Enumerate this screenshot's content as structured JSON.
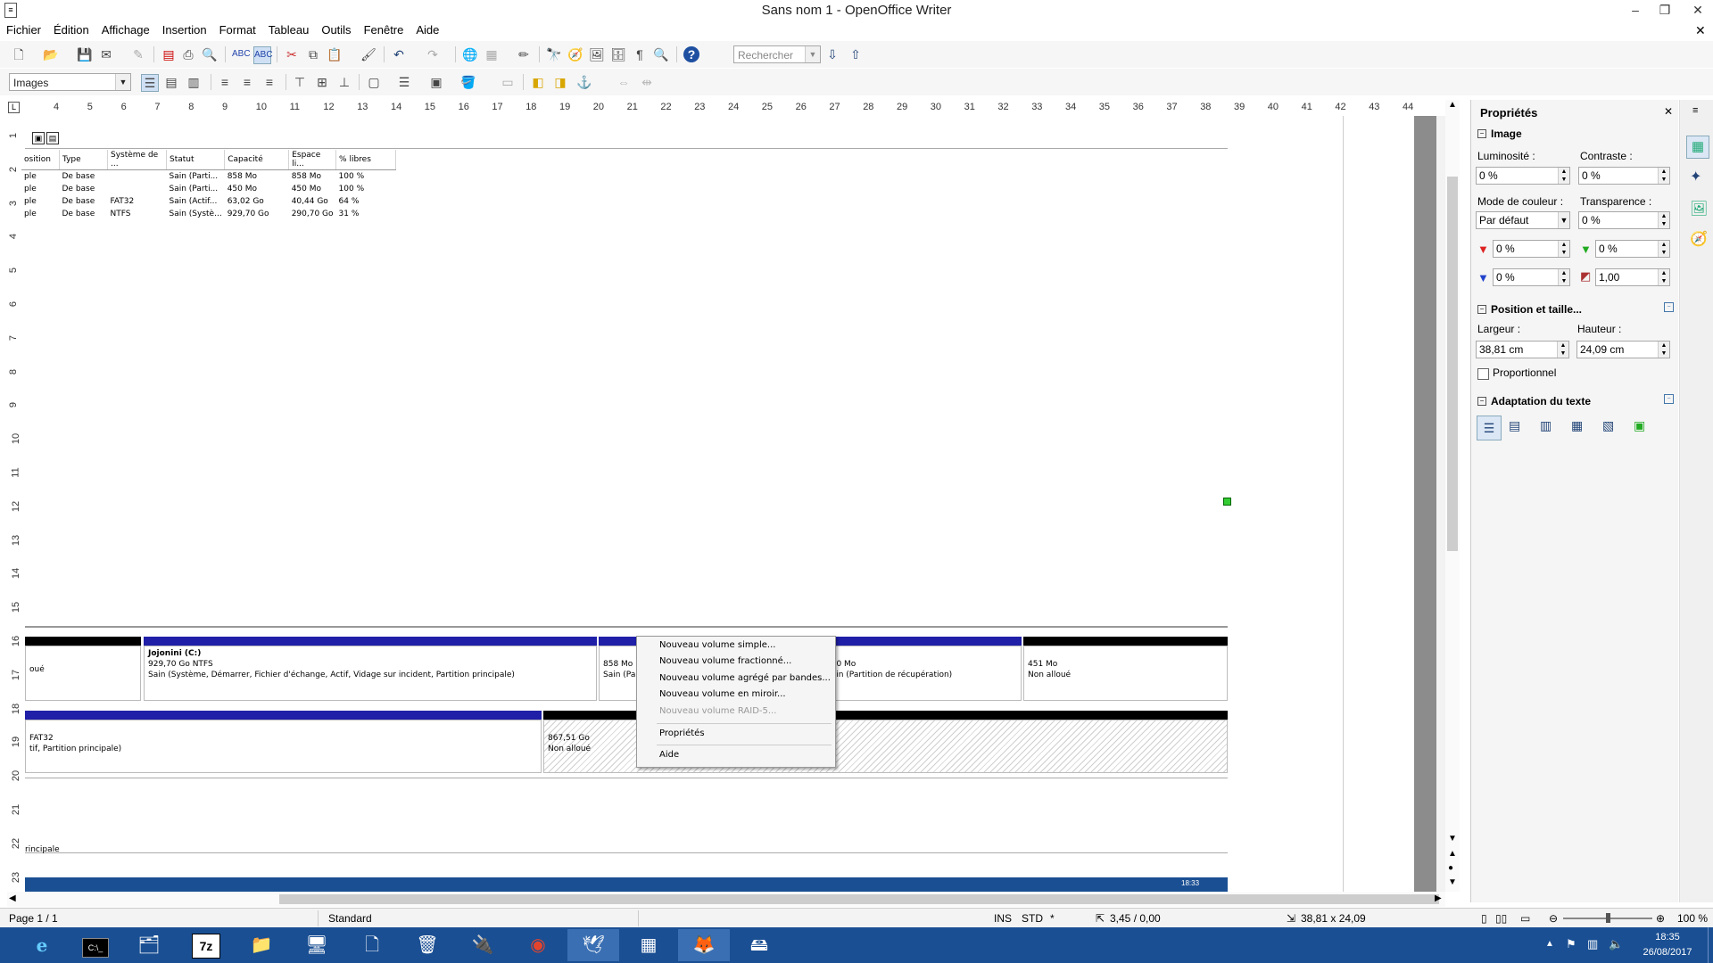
{
  "window": {
    "title": "Sans nom 1 - OpenOffice Writer"
  },
  "menu": [
    "Fichier",
    "Édition",
    "Affichage",
    "Insertion",
    "Format",
    "Tableau",
    "Outils",
    "Fenêtre",
    "Aide"
  ],
  "toolbar1": {
    "search_placeholder": "Rechercher"
  },
  "toolbar2": {
    "style_value": "Images"
  },
  "ruler": {
    "h": [
      "4",
      "5",
      "6",
      "7",
      "8",
      "9",
      "10",
      "11",
      "12",
      "13",
      "14",
      "15",
      "16",
      "17",
      "18",
      "19",
      "20",
      "21",
      "22",
      "23",
      "24",
      "25",
      "26",
      "27",
      "28",
      "29",
      "30",
      "31",
      "32",
      "33",
      "34",
      "35",
      "36",
      "37",
      "38",
      "39",
      "40",
      "41",
      "42",
      "43",
      "44"
    ],
    "v": [
      "1",
      "2",
      "3",
      "4",
      "5",
      "6",
      "7",
      "8",
      "9",
      "10",
      "11",
      "12",
      "13",
      "14",
      "15",
      "16",
      "17",
      "18",
      "19",
      "20",
      "21",
      "22",
      "23"
    ]
  },
  "disk_table": {
    "headers": [
      "osition",
      "Type",
      "Système de ...",
      "Statut",
      "Capacité",
      "Espace li...",
      "% libres"
    ],
    "rows": [
      [
        "ple",
        "De base",
        "",
        "Sain (Parti...",
        "858 Mo",
        "858 Mo",
        "100 %"
      ],
      [
        "ple",
        "De base",
        "",
        "Sain (Parti...",
        "450 Mo",
        "450 Mo",
        "100 %"
      ],
      [
        "ple",
        "De base",
        "FAT32",
        "Sain (Actif...",
        "63,02 Go",
        "40,44 Go",
        "64 %"
      ],
      [
        "ple",
        "De base",
        "NTFS",
        "Sain (Systè...",
        "929,70 Go",
        "290,70 Go",
        "31 %"
      ]
    ]
  },
  "partitions": {
    "p0": "oué",
    "jojonini_title": "Jojonini  (C:)",
    "jojonini_size": "929,70 Go NTFS",
    "jojonini_status": "Sain (Système, Démarrer, Fichier d'échange, Actif, Vidage sur incident, Partition principale)",
    "p858_size": "858 Mo",
    "p858_status": "Sain (Partition de récupération)",
    "p450_size": "450 Mo",
    "p450_status": "Sain (Partition de récupération)",
    "p451_size": "451 Mo",
    "p451_status": "Non alloué",
    "fat_line1": "FAT32",
    "fat_line2": "tif, Partition principale)",
    "unalloc_size": "867,51 Go",
    "unalloc_status": "Non alloué",
    "bottom_label": "rincipale",
    "embedded_clock": "18:33"
  },
  "context_menu": {
    "items": [
      "Nouveau volume simple...",
      "Nouveau volume fractionné...",
      "Nouveau volume agrégé par bandes...",
      "Nouveau volume en miroir...",
      "Nouveau volume RAID-5..."
    ],
    "props": "Propriétés",
    "help": "Aide"
  },
  "sidebar": {
    "title": "Propriétés",
    "image_section": "Image",
    "luminosite_label": "Luminosité :",
    "luminosite": "0 %",
    "contraste_label": "Contraste :",
    "contraste": "0 %",
    "mode_label": "Mode de couleur :",
    "mode": "Par défaut",
    "transparence_label": "Transparence :",
    "transparence": "0 %",
    "red": "0 %",
    "green": "0 %",
    "blue": "0 %",
    "gamma": "1,00",
    "pos_section": "Position et taille...",
    "largeur_label": "Largeur :",
    "largeur": "38,81 cm",
    "hauteur_label": "Hauteur :",
    "hauteur": "24,09 cm",
    "proportionnel": "Proportionnel",
    "wrap_section": "Adaptation du texte"
  },
  "status": {
    "page": "Page 1 / 1",
    "style": "Standard",
    "ins": "INS",
    "std": "STD",
    "star": "*",
    "pos": "3,45 / 0,00",
    "size": "38,81 x 24,09",
    "zoom": "100 %"
  },
  "taskbar": {
    "time": "18:35",
    "date": "26/08/2017"
  },
  "colors": {
    "taskbar": "#1a4f93",
    "partition_blue": "#1f1fa8",
    "partition_black": "#000000"
  }
}
